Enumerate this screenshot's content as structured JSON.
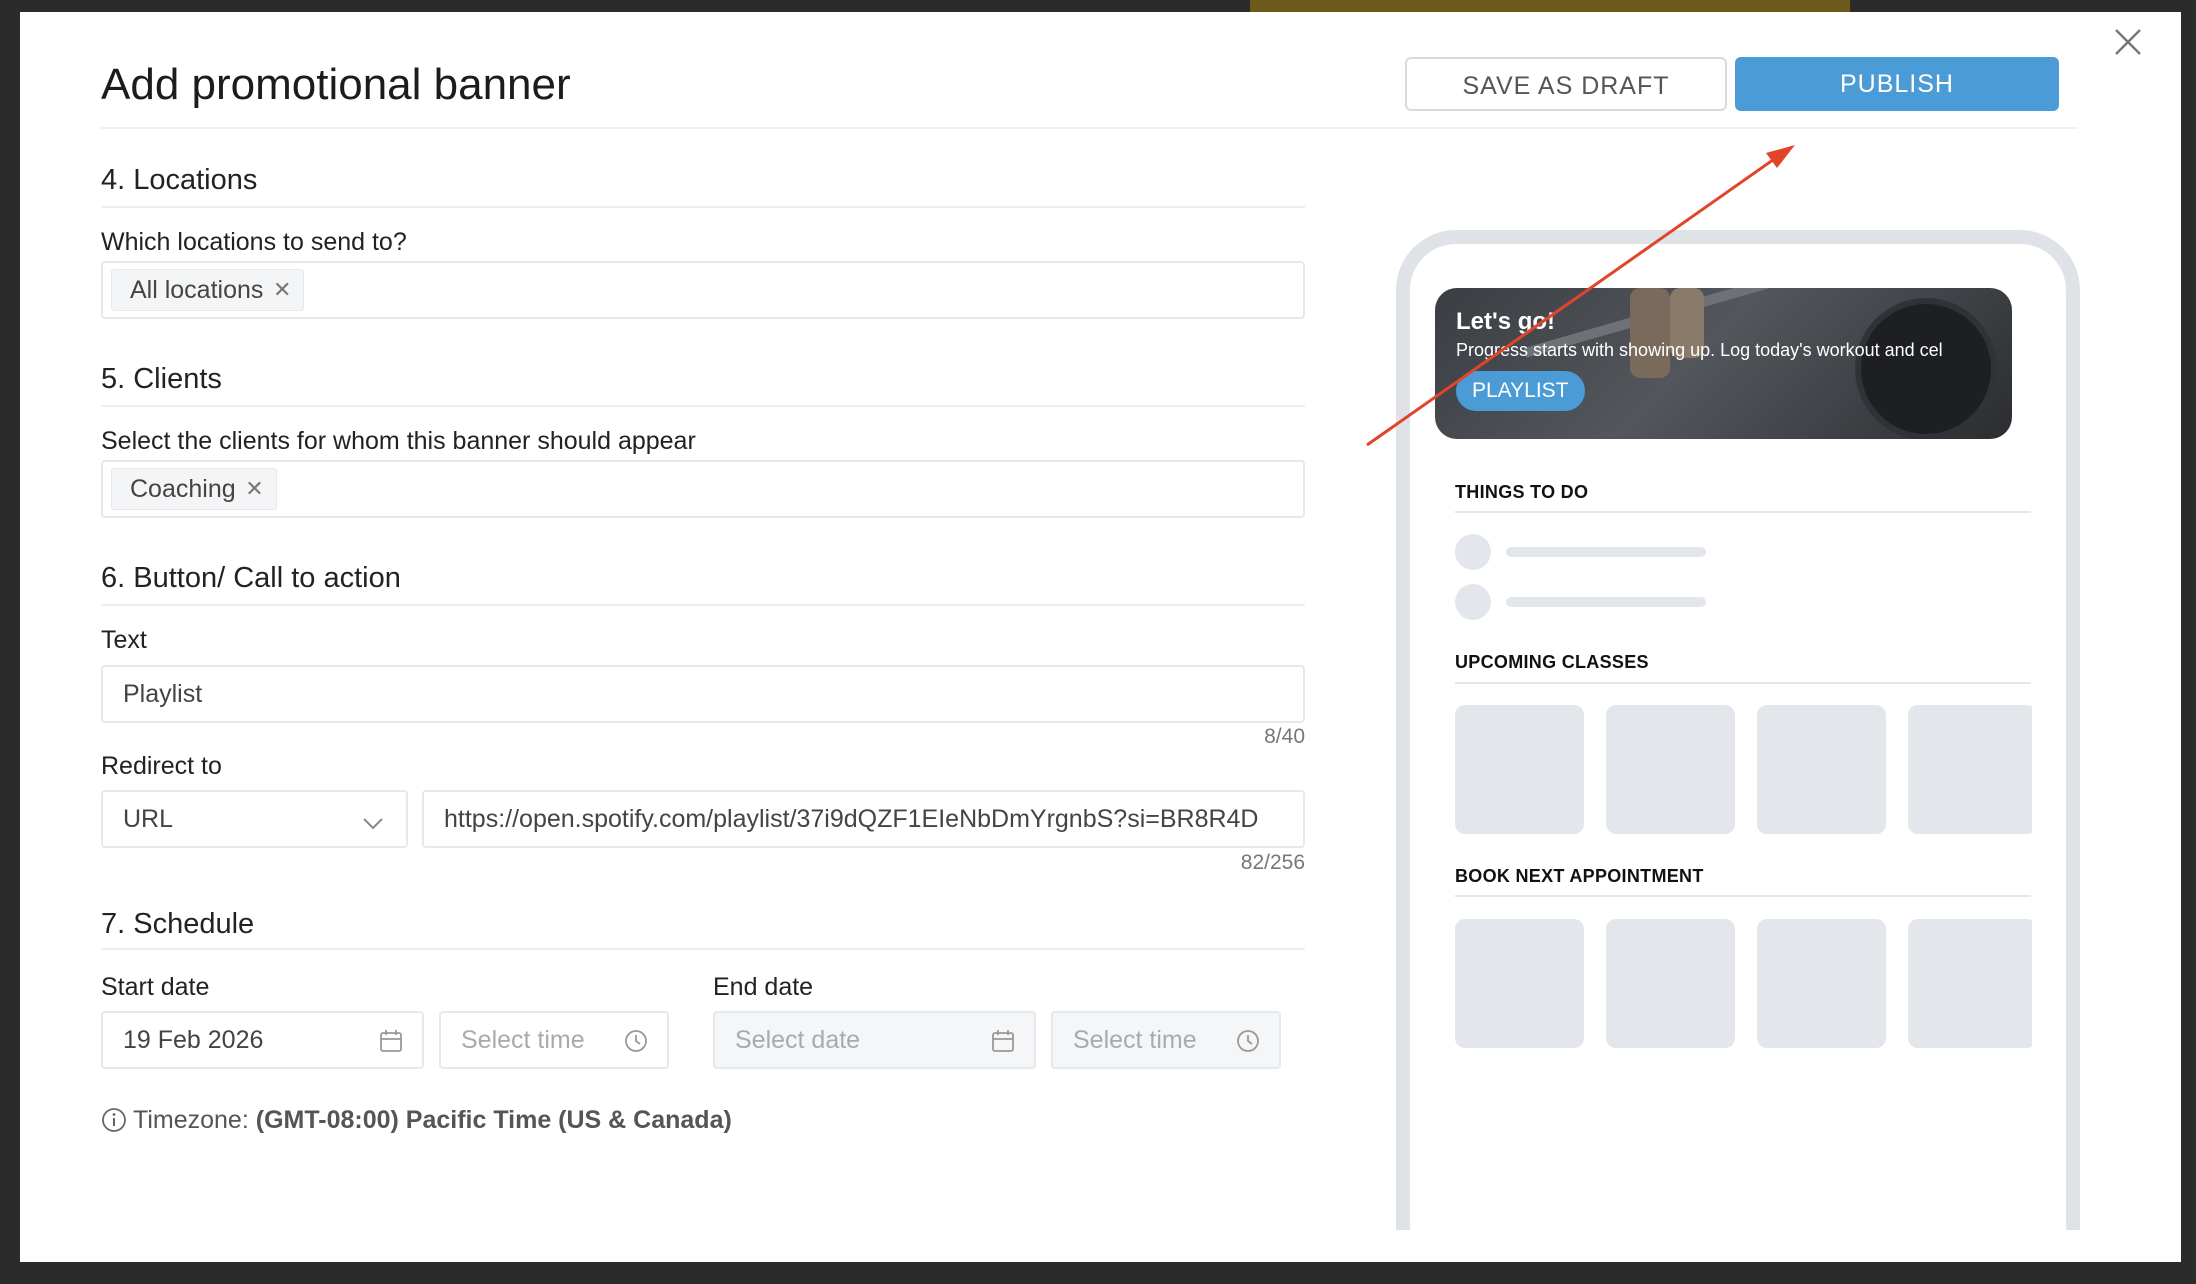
{
  "modal": {
    "title": "Add promotional banner",
    "save_draft_label": "SAVE AS DRAFT",
    "publish_label": "PUBLISH"
  },
  "locations": {
    "heading": "4. Locations",
    "question": "Which locations to send to?",
    "tags": [
      "All locations"
    ]
  },
  "clients": {
    "heading": "5. Clients",
    "question": "Select the clients for whom this banner should appear",
    "tags": [
      "Coaching"
    ]
  },
  "cta": {
    "heading": "6. Button/ Call to action",
    "text_label": "Text",
    "text_value": "Playlist",
    "text_counter": "8/40",
    "redirect_label": "Redirect to",
    "redirect_type": "URL",
    "redirect_url": "https://open.spotify.com/playlist/37i9dQZF1EIeNbDmYrgnbS?si=BR8R4D",
    "url_counter": "82/256"
  },
  "schedule": {
    "heading": "7. Schedule",
    "start_label": "Start date",
    "start_date": "19 Feb 2026",
    "start_time_placeholder": "Select time",
    "end_label": "End date",
    "end_date_placeholder": "Select date",
    "end_time_placeholder": "Select time",
    "timezone_prefix": "Timezone:",
    "timezone_value": "(GMT-08:00) Pacific Time (US & Canada)"
  },
  "preview": {
    "banner_title": "Let's go!",
    "banner_subtitle": "Progress starts with showing up. Log today's workout and cel",
    "banner_button": "PLAYLIST",
    "section_things": "THINGS TO DO",
    "section_classes": "UPCOMING CLASSES",
    "section_appointment": "BOOK NEXT APPOINTMENT"
  },
  "colors": {
    "accent": "#4a9bd6",
    "annotation_arrow": "#e0452b",
    "placeholder_grey": "#e3e6ea"
  },
  "icons": {
    "close": "close-icon",
    "calendar": "calendar-icon",
    "clock": "clock-icon",
    "chevron": "chevron-down-icon",
    "info": "info-icon"
  }
}
